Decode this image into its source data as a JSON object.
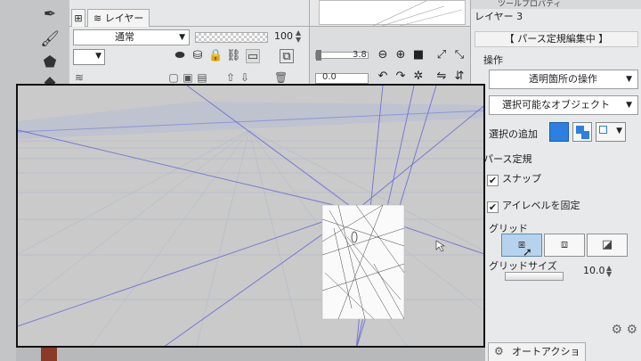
{
  "layer_panel": {
    "tab_layer": "レイヤー",
    "blend_mode": "通常",
    "opacity": "100"
  },
  "navigator": {
    "zoom": "3.8",
    "rotation": "0.0"
  },
  "tool_property": {
    "header": "ツールプロパティ",
    "layer_name": "レイヤー 3",
    "mode_title": "【 パース定規編集中 】",
    "section_operation": "操作",
    "operation_value": "透明箇所の操作",
    "selectable_value": "選択可能なオブジェクト",
    "add_selection_label": "選択の追加",
    "section_perspective": "パース定規",
    "snap_label": "スナップ",
    "snap_checked": true,
    "fix_eye_label": "アイレベルを固定",
    "fix_eye_checked": true,
    "grid_label": "グリッド",
    "grid_size_label": "グリッドサイズ",
    "grid_size_value": "10.0"
  },
  "auto_action": {
    "tab_label": "オートアクション"
  },
  "colors": {
    "accent_blue": "#2d7fe0",
    "grid_line": "#9aa6dc",
    "perspective_line": "#6f72d6"
  },
  "icons": [
    "pen-icon",
    "brush-icon",
    "fill-icon",
    "eye-icon",
    "lock-icon",
    "zoom-in-icon",
    "zoom-out-icon",
    "rotate-icon",
    "cursor-icon",
    "settings-icon"
  ]
}
